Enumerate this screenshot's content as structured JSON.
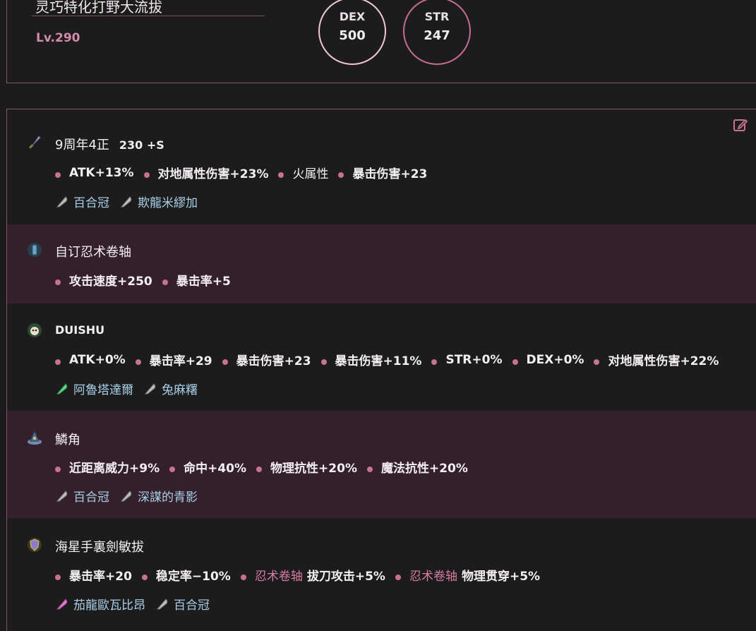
{
  "header": {
    "build_name": "灵巧特化打野大流拔",
    "level": "Lv.290",
    "stats": [
      {
        "name": "DEX",
        "value": "500"
      },
      {
        "name": "STR",
        "value": "247"
      }
    ]
  },
  "colors": {
    "accent": "#c9728f",
    "border": "#8a4f6a",
    "alt_row": "#33202a",
    "gem_text": "#a9cfe8"
  },
  "items": [
    {
      "icon": "sword-icon",
      "title": "9周年4正",
      "title_extra": "230 +S",
      "stats": [
        {
          "text": "ATK+13%"
        },
        {
          "text": "对地属性伤害+23%"
        },
        {
          "text": "火属性"
        },
        {
          "text": "暴击伤害+23"
        }
      ],
      "gems": [
        {
          "icon": "feather-icon",
          "label": "百合冠"
        },
        {
          "icon": "feather-icon",
          "label": "欺龍米繆加"
        }
      ]
    },
    {
      "icon": "scroll-icon",
      "title": "自订忍术卷轴",
      "stats": [
        {
          "text": "攻击速度+250"
        },
        {
          "text": "暴击率+5"
        }
      ],
      "gems": []
    },
    {
      "icon": "pet-icon",
      "title": "DUISHU",
      "stats": [
        {
          "text": "ATK+0%"
        },
        {
          "text": "暴击率+29"
        },
        {
          "text": "暴击伤害+23"
        },
        {
          "text": "暴击伤害+11%"
        },
        {
          "text": "STR+0%"
        },
        {
          "text": "DEX+0%"
        },
        {
          "text": "对地属性伤害+22%"
        }
      ],
      "gems": [
        {
          "icon": "green-crystal-icon",
          "label": "阿魯塔達爾"
        },
        {
          "icon": "feather-icon",
          "label": "兔麻糬"
        }
      ]
    },
    {
      "icon": "hat-icon",
      "title": "鱗角",
      "stats": [
        {
          "text": "近距离威力+9%"
        },
        {
          "text": "命中+40%"
        },
        {
          "text": "物理抗性+20%"
        },
        {
          "text": "魔法抗性+20%"
        }
      ],
      "gems": [
        {
          "icon": "feather-icon",
          "label": "百合冠"
        },
        {
          "icon": "feather-icon",
          "label": "深謀的青影"
        }
      ]
    },
    {
      "icon": "shield-icon",
      "title": "海星手裏劍敏拔",
      "stats": [
        {
          "text": "暴击率+20"
        },
        {
          "text": "稳定率−10%"
        },
        {
          "prefix": "忍术卷轴",
          "text": "拔刀攻击+5%"
        },
        {
          "prefix": "忍术卷轴",
          "text": "物理贯穿+5%"
        }
      ],
      "gems": [
        {
          "icon": "pink-crystal-icon",
          "label": "茄龍歐瓦比昂"
        },
        {
          "icon": "feather-icon",
          "label": "百合冠"
        }
      ]
    }
  ]
}
